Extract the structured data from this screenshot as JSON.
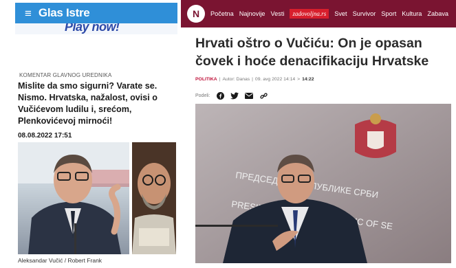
{
  "glas_istre": {
    "logo": "Glas Istre",
    "banner_text": "Play now!",
    "section_label": "KOMENTAR GLAVNOG UREDNIKA",
    "headline": "Mislite da smo sigurni? Varate se. Nismo. Hrvatska, nažalost, ovisi o Vučićevom ludilu i, srećom, Plenkovićevoj mirnoći!",
    "date": "08.08.2022 17:51",
    "caption": "Aleksandar Vučić / Robert Frank",
    "colors": {
      "header": "#2f8fd8",
      "banner_text": "#2d4aa8"
    }
  },
  "n1": {
    "logo": "N",
    "nav_items": [
      "Početna",
      "Najnovije",
      "Vesti",
      "zadovoljna.rs",
      "Svet",
      "Survivor",
      "Sport",
      "Kultura",
      "Zabava"
    ],
    "title": "Hrvati oštro o Vučiću: On je opasan čovek i hoće denacifikaciju Hrvatske",
    "meta": {
      "category": "POLITIKA",
      "separator": "|",
      "author": "Autor: Danas",
      "date": "09. avg 2022 14:14",
      "separator2": ">",
      "time": "14:22"
    },
    "share_label": "Podeli:",
    "share_icons": [
      "facebook-icon",
      "twitter-icon",
      "email-icon",
      "link-icon"
    ],
    "photo_sign_line1": "ПРЕДСЕДНИК РЕПУБЛИКЕ СРБИ",
    "photo_sign_line2": "PRESIDENT OF THE REPUBLIC OF SE",
    "colors": {
      "nav": "#7a1431",
      "accent": "#c0143c",
      "badge": "#d81e2c"
    }
  }
}
